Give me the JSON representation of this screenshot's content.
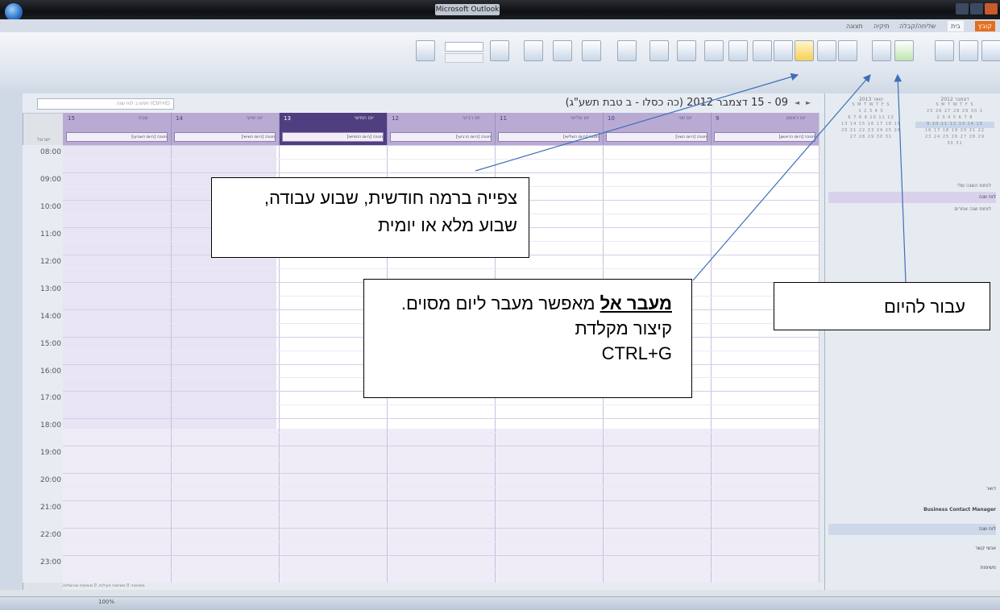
{
  "window": {
    "title": "Microsoft Outlook"
  },
  "ribbon": {
    "tabs": [
      "קובץ",
      "בית",
      "שליחה/קבלה",
      "תיקיה",
      "תצוגה"
    ]
  },
  "calendar": {
    "date_range": "09 - 15 דצמבר 2012 (כה כסלו - ב טבת תשע\"ג)",
    "search_placeholder": "חפש ב לוח שנה (Ctrl+E)",
    "israel_label": "ישראל",
    "days": [
      {
        "num": "9",
        "name": "יום ראשון",
        "event": "חנוכה [היום הראשון]"
      },
      {
        "num": "10",
        "name": "יום שני",
        "event": "חנוכה [היום השני]"
      },
      {
        "num": "11",
        "name": "יום שלישי",
        "event": "חנוכה [היום השלישי]"
      },
      {
        "num": "12",
        "name": "יום רביעי",
        "event": "חנוכה [היום הרביעי]"
      },
      {
        "num": "13",
        "name": "יום חמישי",
        "event": "חנוכה [היום החמישי]"
      },
      {
        "num": "14",
        "name": "יום שישי",
        "event": "חנוכה [היום השישי]"
      },
      {
        "num": "15",
        "name": "שבת",
        "event": "חנוכה [היום השביעי]"
      }
    ],
    "hours": [
      "08:00",
      "09:00",
      "10:00",
      "11:00",
      "12:00",
      "13:00",
      "14:00",
      "15:00",
      "16:00",
      "17:00",
      "18:00",
      "19:00",
      "20:00",
      "21:00",
      "22:00",
      "23:00"
    ],
    "status_text": "משימות: 0 משימות פעילות, 0 משימות שהושלמו"
  },
  "right_pane": {
    "mini_cal_1": "דצמבר 2012",
    "mini_cal_2": "ינואר 2013",
    "section_title": "לוחות השנה שלי",
    "calendar_item": "לוח שנה",
    "other_calendars": "לוחות שנה אחרים",
    "nav": [
      "דואר",
      "Business Contact Manager",
      "לוח שנה",
      "אנשי קשר",
      "משימות"
    ]
  },
  "callouts": {
    "views": "צפייה ברמה חודשית, שבוע עבודה, שבוע מלא או יומית",
    "goto_bold": "מעבר אל",
    "goto_rest": " מאפשר מעבר ליום מסוים. קיצור מקלדת",
    "goto_shortcut": "CTRL+G",
    "today": "עבור להיום"
  },
  "statusbar": {
    "zoom": "100%"
  }
}
